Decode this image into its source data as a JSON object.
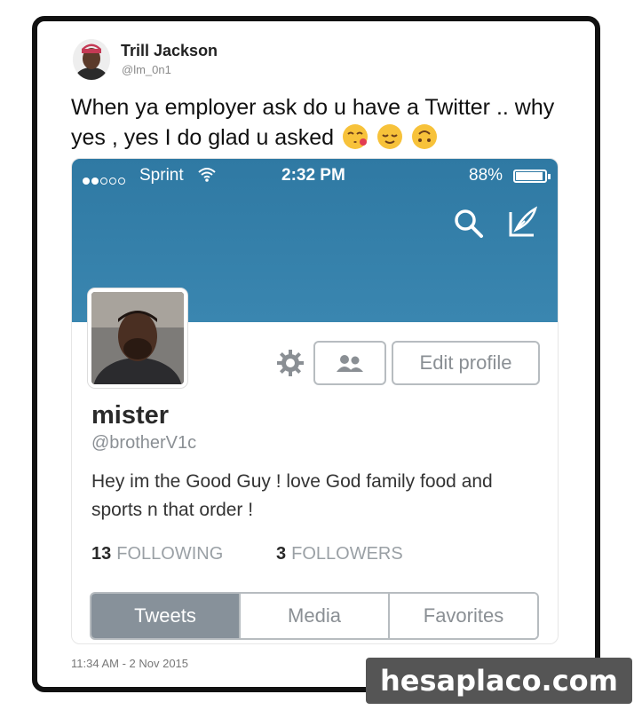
{
  "tweet": {
    "author_name": "Trill Jackson",
    "author_handle": "@lm_0n1",
    "text": "When ya employer ask do u have a Twitter .. why yes , yes I do glad u asked",
    "emojis": [
      "kissing-heart-emoji",
      "relieved-emoji",
      "upside-down-face-emoji"
    ],
    "timestamp": "11:34 AM - 2 Nov 2015"
  },
  "status_bar": {
    "carrier": "Sprint",
    "time": "2:32 PM",
    "battery": "88%",
    "battery_level": 0.88,
    "signal_bars": 2
  },
  "profile": {
    "display_name": "mister",
    "username": "@brotherV1c",
    "bio": "Hey im the Good Guy ! love God family food and sports n that order !",
    "following_count": "13",
    "following_label": "FOLLOWING",
    "followers_count": "3",
    "followers_label": "FOLLOWERS",
    "edit_profile_label": "Edit profile"
  },
  "tabs": [
    {
      "label": "Tweets",
      "active": true
    },
    {
      "label": "Media",
      "active": false
    },
    {
      "label": "Favorites",
      "active": false
    }
  ],
  "watermark": "hesaplaco.com",
  "colors": {
    "header_blue": "#3582ad",
    "active_tab": "#87919a",
    "button_border": "#b7bcc0"
  }
}
